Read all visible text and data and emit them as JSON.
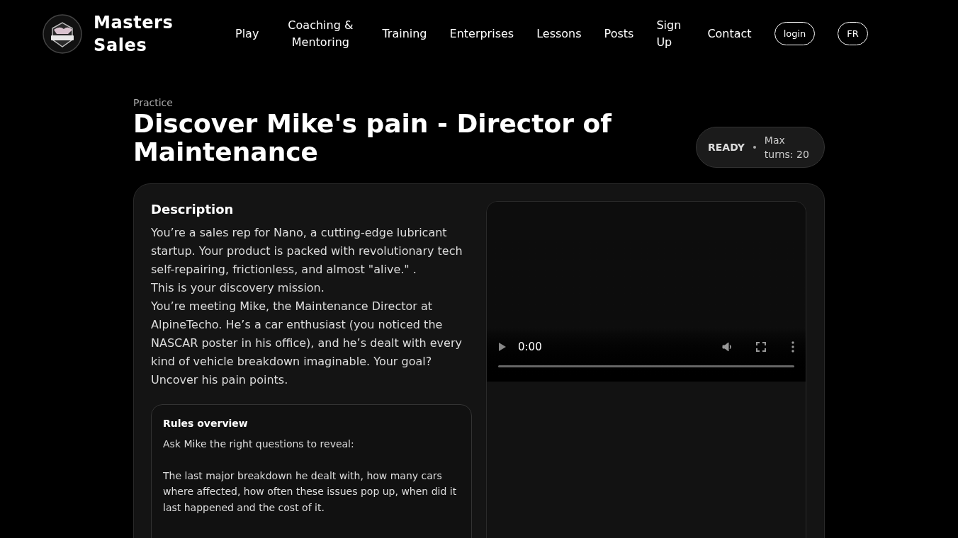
{
  "header": {
    "brand": "Masters Sales",
    "nav": [
      {
        "label": "Play",
        "kind": "link"
      },
      {
        "label": "Coaching & Mentoring",
        "kind": "link"
      },
      {
        "label": "Training",
        "kind": "link"
      },
      {
        "label": "Enterprises",
        "kind": "link"
      },
      {
        "label": "Lessons",
        "kind": "link"
      },
      {
        "label": "Posts",
        "kind": "link"
      },
      {
        "label": "Sign Up",
        "kind": "link"
      },
      {
        "label": "Contact",
        "kind": "link"
      },
      {
        "label": "login",
        "kind": "pill"
      },
      {
        "label": "FR",
        "kind": "pill"
      }
    ]
  },
  "page": {
    "eyebrow": "Practice",
    "title": "Discover Mike's pain - Director of Maintenance",
    "status": "READY",
    "max_turns": "Max turns: 20"
  },
  "description": {
    "heading": "Description",
    "paragraphs": [
      "You’re a sales rep for Nano, a cutting-edge lubricant startup. Your product is packed with revolutionary tech self-repairing, frictionless, and almost \"alive.\" .",
      "This is your discovery mission.",
      "You’re meeting Mike, the Maintenance Director at AlpineTecho. He’s a car enthusiast (you noticed the NASCAR poster in his office), and he’s dealt with every kind of vehicle breakdown imaginable. Your goal? Uncover his pain points."
    ]
  },
  "rules": {
    "heading": "Rules overview",
    "paragraphs": [
      "Ask Mike the right questions to reveal:",
      "The last major breakdown he dealt with, how many cars where affected, how often these issues pop up, when did it last happened and the cost of it."
    ]
  },
  "video": {
    "time": "0:00"
  }
}
